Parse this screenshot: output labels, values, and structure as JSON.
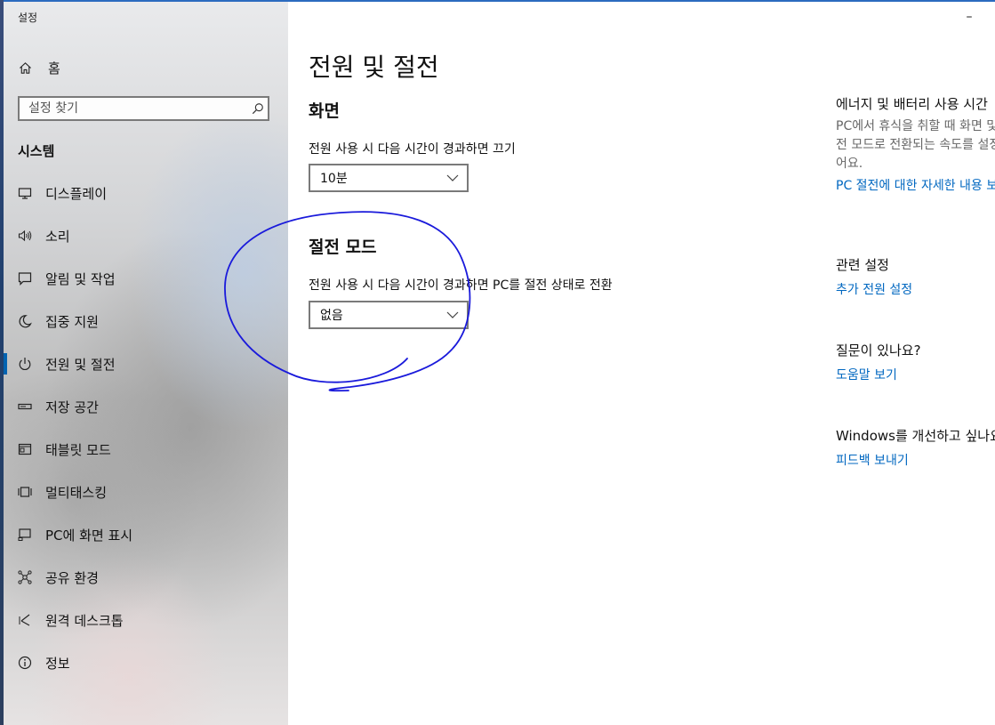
{
  "window": {
    "title": "설정",
    "minimize_glyph": "–"
  },
  "sidebar": {
    "home_label": "홈",
    "home_icon": "home-icon",
    "search_placeholder": "설정 찾기",
    "search_icon": "search-icon",
    "section_title": "시스템",
    "items": [
      {
        "label": "디스플레이",
        "icon": "display-icon",
        "selected": false
      },
      {
        "label": "소리",
        "icon": "speaker-icon",
        "selected": false
      },
      {
        "label": "알림 및 작업",
        "icon": "notification-icon",
        "selected": false
      },
      {
        "label": "집중 지원",
        "icon": "moon-icon",
        "selected": false
      },
      {
        "label": "전원 및 절전",
        "icon": "power-icon",
        "selected": true
      },
      {
        "label": "저장 공간",
        "icon": "storage-icon",
        "selected": false
      },
      {
        "label": "태블릿 모드",
        "icon": "tablet-icon",
        "selected": false
      },
      {
        "label": "멀티태스킹",
        "icon": "multitasking-icon",
        "selected": false
      },
      {
        "label": "PC에 화면 표시",
        "icon": "project-icon",
        "selected": false
      },
      {
        "label": "공유 환경",
        "icon": "shared-experiences-icon",
        "selected": false
      },
      {
        "label": "원격 데스크톱",
        "icon": "remote-desktop-icon",
        "selected": false
      },
      {
        "label": "정보",
        "icon": "info-icon",
        "selected": false
      }
    ]
  },
  "main": {
    "page_title": "전원 및 절전",
    "screen": {
      "heading": "화면",
      "label": "전원 사용 시 다음 시간이 경과하면 끄기",
      "selected_value": "10분"
    },
    "sleep": {
      "heading": "절전 모드",
      "label": "전원 사용 시 다음 시간이 경과하면 PC를 절전 상태로 전환",
      "selected_value": "없음"
    }
  },
  "related": {
    "energy_heading": "에너지 및 배터리 사용 시간",
    "energy_desc": "PC에서 휴식을 취할 때 화면 및 PC가 절전 모드로 전환되는 속도를 설정할 수 있어요.",
    "energy_link": "PC 절전에 대한 자세한 내용 보기",
    "related_heading": "관련 설정",
    "related_link": "추가 전원 설정",
    "question_heading": "질문이 있나요?",
    "help_link": "도움말 보기",
    "feedback_heading": "Windows를 개선하고 싶나요?",
    "feedback_link": "피드백 보내기"
  },
  "colors": {
    "accent": "#0063b1",
    "link": "#0067c0",
    "annotation_ink": "#1a1adb"
  }
}
